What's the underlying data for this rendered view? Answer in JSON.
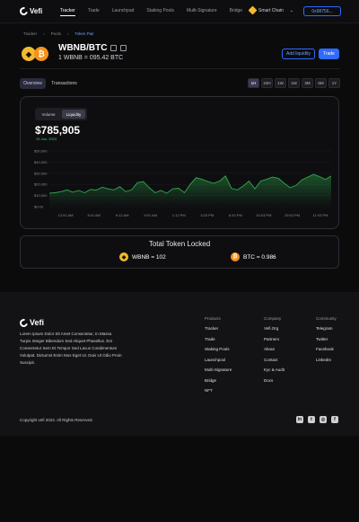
{
  "app": {
    "logo_text": "Vefi"
  },
  "nav": {
    "items": [
      {
        "label": "Tracker",
        "active": true
      },
      {
        "label": "Trade"
      },
      {
        "label": "Launchpad"
      },
      {
        "label": "Staking Pools"
      },
      {
        "label": "Multi-Signature"
      },
      {
        "label": "Bridge"
      }
    ],
    "chain": "Smart Chain",
    "wallet": "0x98756..."
  },
  "breadcrumb": [
    "Tracker",
    "Pools",
    "Token Pair"
  ],
  "pair": {
    "name": "WBNB/BTC",
    "rate": "1 WBNB = 095.42 BTC",
    "add_liquidity": "Add liquidity",
    "trade": "Trade"
  },
  "tabs": [
    "Overview",
    "Transactions"
  ],
  "ranges": [
    "1H",
    "24H",
    "1W",
    "1M",
    "3M",
    "6M",
    "1Y"
  ],
  "chart_toggle": [
    "Volume",
    "Liquidity"
  ],
  "headline": {
    "value": "$785,905",
    "date": "15 Jan, 2023"
  },
  "colors": {
    "accent": "#2f6bff",
    "line": "#2ea84a"
  },
  "chart_data": {
    "type": "area",
    "x": [
      "12:51 AM",
      "3:01 AM",
      "6:12 AM",
      "9:01 AM",
      "1:12 PM",
      "3:33 PM",
      "6:43 PM",
      "10:03 PM",
      "10:53 PM",
      "11:03 PM"
    ],
    "yticks": [
      "$50,000",
      "$40,000",
      "$30,000",
      "$20,000",
      "$10,000",
      "$0.00"
    ],
    "ylim": [
      0,
      50000
    ],
    "series": [
      {
        "values": [
          12000,
          12500,
          13500,
          15000,
          13000,
          14500,
          12500,
          15500,
          14800,
          17500,
          16000,
          15000,
          18000,
          13500,
          15000,
          21500,
          22500,
          17000,
          12500,
          14500,
          12000,
          16000,
          16500,
          12500,
          20000,
          26000,
          24500,
          22500,
          21000,
          23000,
          27500,
          16500,
          15000,
          18500,
          23000,
          16000,
          23000,
          24500,
          26500,
          25500,
          21000,
          17000,
          19000,
          24000,
          26500,
          29000,
          27000,
          24500,
          27500
        ]
      }
    ]
  },
  "tvl": {
    "title": "Total Token Locked",
    "items": [
      {
        "label": "WBNB = 102"
      },
      {
        "label": "BTC = 0.986"
      }
    ]
  },
  "footer": {
    "logo_text": "Vefi",
    "description": "Lorem Ipsum Dolor Sit Amet Consectetur, In Massa Turpis Integer Bibendum Sed Aliquet Phasellus. Est Consectetur Sem Et Tempor Sed Lacus Condimentum Volutpat. Dictumst Enim Mus Eget Ut. Duis Ut Odio Proin Suscipit.",
    "columns": [
      {
        "title": "Products",
        "links": [
          "Tracker",
          "Trade",
          "Staking Pools",
          "Launchpool",
          "Multi-Signature",
          "Bridge",
          "NFT"
        ]
      },
      {
        "title": "Company",
        "links": [
          "Vefi.Org",
          "Partners",
          "About",
          "Contact",
          "Kyc & Audit",
          "Docs"
        ]
      },
      {
        "title": "Community",
        "links": [
          "Telegram",
          "Twitter",
          "Facebook",
          "LinkedIn"
        ]
      }
    ],
    "copyright": "Copyright vefi 2023. All Rights Reserved.",
    "social": [
      "linkedin-icon",
      "twitter-icon",
      "instagram-icon",
      "facebook-icon"
    ]
  }
}
